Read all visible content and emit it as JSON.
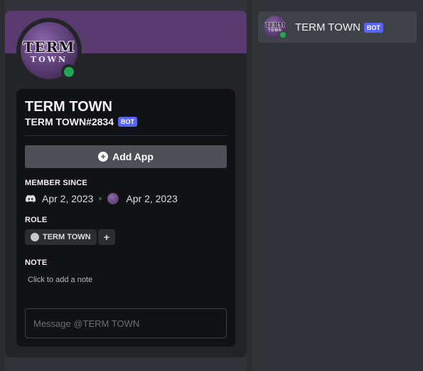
{
  "profile": {
    "avatar_line1": "TERM",
    "avatar_line2": "TOWN",
    "display_name": "TERM TOWN",
    "username": "TERM TOWN#2834",
    "bot_badge": "BOT",
    "add_app_label": "Add App",
    "member_since_title": "MEMBER SINCE",
    "discord_since": "Apr 2, 2023",
    "server_since": "Apr 2, 2023",
    "role_title": "ROLE",
    "role_name": "TERM TOWN",
    "role_add": "+",
    "note_title": "NOTE",
    "note_placeholder": "Click to add a note",
    "message_placeholder": "Message @TERM TOWN",
    "status": "online"
  },
  "member_list": {
    "items": [
      {
        "name": "TERM TOWN",
        "badge": "BOT",
        "avatar_line1": "TERM",
        "avatar_line2": "TOWN",
        "status": "online"
      }
    ]
  },
  "colors": {
    "background": "#313338",
    "banner": "#583a6e",
    "online": "#23a559",
    "bot_badge": "#5865f2"
  }
}
